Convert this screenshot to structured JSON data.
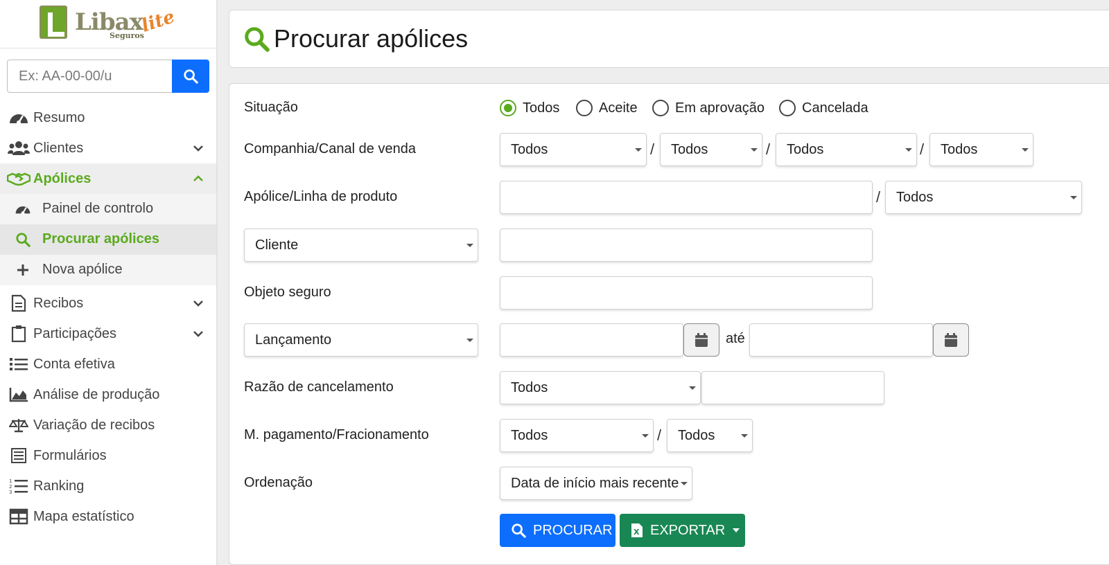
{
  "app": {
    "logo_text": "Libax",
    "logo_sub": "Seguros",
    "logo_suffix": "lite"
  },
  "sidebar": {
    "search_placeholder": "Ex: AA-00-00/u",
    "items": [
      {
        "label": "Resumo",
        "icon": "dashboard-icon"
      },
      {
        "label": "Clientes",
        "icon": "users-icon",
        "expandable": true
      },
      {
        "label": "Apólices",
        "icon": "handshake-icon",
        "expandable": true,
        "expanded": true,
        "active": true
      },
      {
        "label": "Recibos",
        "icon": "file-icon",
        "expandable": true
      },
      {
        "label": "Participações",
        "icon": "clipboard-icon",
        "expandable": true
      },
      {
        "label": "Conta efetiva",
        "icon": "list-icon"
      },
      {
        "label": "Análise de produção",
        "icon": "area-chart-icon"
      },
      {
        "label": "Variação de recibos",
        "icon": "scale-icon"
      },
      {
        "label": "Formulários",
        "icon": "form-icon"
      },
      {
        "label": "Ranking",
        "icon": "ordered-list-icon"
      },
      {
        "label": "Mapa estatístico",
        "icon": "table-icon"
      }
    ],
    "subitems": [
      {
        "label": "Painel de controlo",
        "icon": "dashboard-icon"
      },
      {
        "label": "Procurar apólices",
        "icon": "search-icon",
        "current": true
      },
      {
        "label": "Nova apólice",
        "icon": "plus-icon"
      }
    ]
  },
  "header": {
    "title": "Procurar apólices"
  },
  "form": {
    "situacao": {
      "label": "Situação",
      "options": [
        "Todos",
        "Aceite",
        "Em aprovação",
        "Cancelada"
      ],
      "selected": "Todos"
    },
    "companhia": {
      "label": "Companhia/Canal de venda",
      "selects": [
        "Todos",
        "Todos",
        "Todos",
        "Todos"
      ]
    },
    "apolice": {
      "label": "Apólice/Linha de produto",
      "value": "",
      "linha": "Todos"
    },
    "cliente": {
      "select": "Cliente",
      "value": ""
    },
    "objeto": {
      "label": "Objeto seguro",
      "value": ""
    },
    "lancamento": {
      "select": "Lançamento",
      "from": "",
      "ate_label": "até",
      "to": ""
    },
    "razao": {
      "label": "Razão de cancelamento",
      "select": "Todos",
      "value": ""
    },
    "pagamento": {
      "label": "M. pagamento/Fracionamento",
      "selects": [
        "Todos",
        "Todos"
      ]
    },
    "ordenacao": {
      "label": "Ordenação",
      "select": "Data de início mais recente"
    },
    "buttons": {
      "search": "PROCURAR",
      "export": "EXPORTAR"
    }
  },
  "colors": {
    "accent_green": "#5aaa1e",
    "primary_blue": "#0d6efd",
    "success_green": "#198754"
  }
}
